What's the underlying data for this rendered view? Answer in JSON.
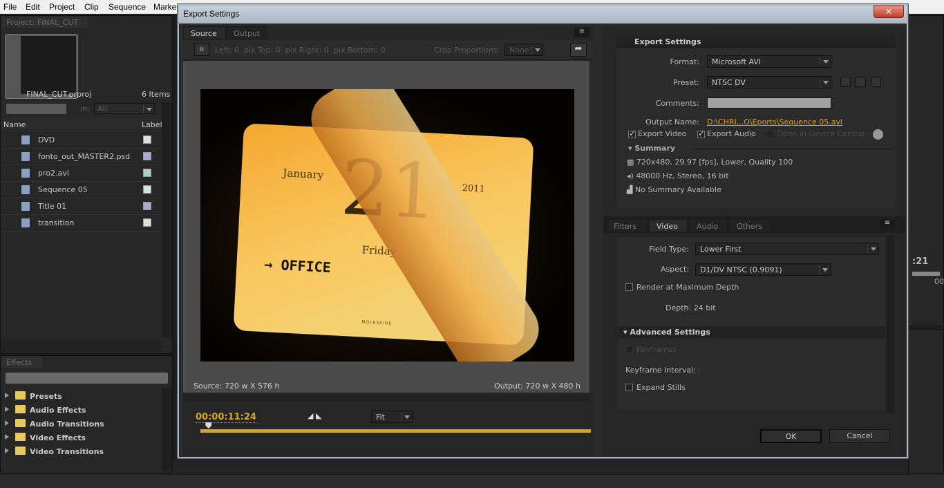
{
  "menu": [
    "File",
    "Edit",
    "Project",
    "Clip",
    "Sequence",
    "Marker"
  ],
  "project": {
    "tab": "Project: FINAL_CUT",
    "file": "FINAL_CUT.prproj",
    "count": "6 Items",
    "in_label": "In:",
    "in_value": "All",
    "col_name": "Name",
    "col_label": "Label",
    "items": [
      {
        "name": "DVD",
        "label_color": "#d8e0e0"
      },
      {
        "name": "fonto_out_MASTER2.psd",
        "label_color": "#a8a8d0"
      },
      {
        "name": "pro2.avi",
        "label_color": "#a8d0c8"
      },
      {
        "name": "Sequence 05",
        "label_color": "#d8e0e0"
      },
      {
        "name": "Title 01",
        "label_color": "#a8a8d0"
      },
      {
        "name": "transition",
        "label_color": "#d8e0e0"
      }
    ]
  },
  "effects": {
    "tab": "Effects",
    "items": [
      "Presets",
      "Audio Effects",
      "Audio Transitions",
      "Video Effects",
      "Video Transitions"
    ]
  },
  "background": {
    "timecode": ":21",
    "tc2": "00"
  },
  "dialog": {
    "title": "Export Settings",
    "source_tabs": [
      "Source",
      "Output"
    ],
    "crop": {
      "left_label": "Left:",
      "left": "0",
      "top_label": "pix Top:",
      "top": "0",
      "right_label": "pix Right:",
      "right": "0",
      "bottom_label": "pix Bottom:",
      "bottom": "0",
      "proportions_label": "Crop Proportions:",
      "proportions": "None"
    },
    "preview": {
      "month": "January",
      "day": "21",
      "year": "2011",
      "weekday": "Friday",
      "note": "→ OFFICE",
      "brand": "MOLESKINE"
    },
    "source_size": "Source: 720 w X 576 h",
    "output_size": "Output: 720 w X 480 h",
    "timecode": "00:00:11:24",
    "zoom": "Fit",
    "playhead_fraction": 0.02,
    "export": {
      "header": "Export Settings",
      "format_label": "Format:",
      "format": "Microsoft AVI",
      "preset_label": "Preset:",
      "preset": "NTSC DV",
      "comments_label": "Comments:",
      "comments": "",
      "output_label": "Output Name:",
      "output": "D:\\CHRI...O\\Eports\\Sequence 05.avi",
      "export_video": "Export Video",
      "export_audio": "Export Audio",
      "device_central": "Open in Device Central",
      "summary": "Summary",
      "summary_lines": [
        "720x480, 29.97 [fps], Lower, Quality 100",
        "48000 Hz, Stereo, 16 bit",
        "No Summary Available"
      ]
    },
    "tabs": [
      "Filters",
      "Video",
      "Audio",
      "Others"
    ],
    "active_tab": "Video",
    "video": {
      "field_label": "Field Type:",
      "field": "Lower First",
      "aspect_label": "Aspect:",
      "aspect": "D1/DV NTSC (0.9091)",
      "render_max": "Render at Maximum Depth",
      "depth_label": "Depth:",
      "depth": "24 bit",
      "advanced": "Advanced Settings",
      "keyframes": "Keyframes",
      "kf_interval_label": "Keyframe Interval:",
      "kf_interval": "1",
      "expand_stills": "Expand Stills"
    },
    "ok": "OK",
    "cancel": "Cancel",
    "accent": "#d9a520"
  }
}
